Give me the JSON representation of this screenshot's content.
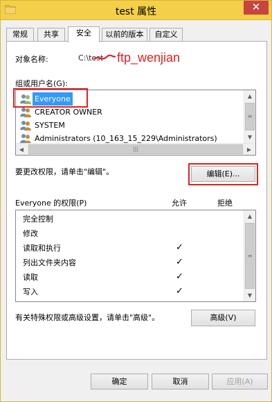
{
  "window": {
    "title": "test 属性",
    "close_label": "✕"
  },
  "tabs": [
    "常规",
    "共享",
    "安全",
    "以前的版本",
    "自定义"
  ],
  "object_name": {
    "label": "对象名称:",
    "value": "C:\\test",
    "annotation": "ftp_wenjian"
  },
  "groups": {
    "label": "组或用户名(G):",
    "items": [
      "Everyone",
      "CREATOR OWNER",
      "SYSTEM",
      "Administrators (10_163_15_229\\Administrators)"
    ],
    "selected_index": 0
  },
  "edit_hint": "要更改权限，请单击\"编辑\"。",
  "edit_button": "编辑(E)...",
  "permissions": {
    "title": "Everyone 的权限(P)",
    "allow_header": "允许",
    "deny_header": "拒绝",
    "rows": [
      {
        "name": "完全控制",
        "allow": false,
        "deny": false
      },
      {
        "name": "修改",
        "allow": false,
        "deny": false
      },
      {
        "name": "读取和执行",
        "allow": true,
        "deny": false
      },
      {
        "name": "列出文件夹内容",
        "allow": true,
        "deny": false
      },
      {
        "name": "读取",
        "allow": true,
        "deny": false
      },
      {
        "name": "写入",
        "allow": true,
        "deny": false
      }
    ],
    "check_glyph": "✓"
  },
  "advanced_hint": "有关特殊权限或高级设置，请单击\"高级\"。",
  "advanced_button": "高级(V)",
  "footer": {
    "ok": "确定",
    "cancel": "取消",
    "apply": "应用(A)"
  },
  "colors": {
    "highlight": "#3399ff",
    "annotation_red": "#e02020",
    "titlebar": "#f3cf4a"
  }
}
